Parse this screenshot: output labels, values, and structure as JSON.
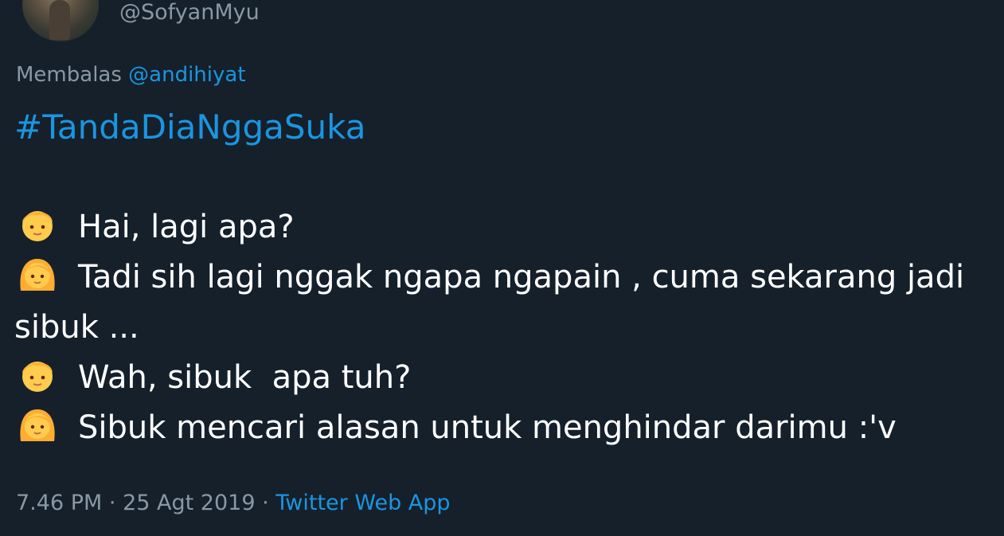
{
  "tweet": {
    "handle": "@SofyanMyu",
    "reply_prefix": "Membalas",
    "reply_to": "@andihiyat",
    "hashtag": "#TandaDiaNggaSuka",
    "dialogue": [
      {
        "speaker_icon": "boy-emoji-icon",
        "text": "Hai, lagi apa?"
      },
      {
        "speaker_icon": "girl-emoji-icon",
        "text": "Tadi sih lagi nggak ngapa ngapain , cuma sekarang jadi sibuk ..."
      },
      {
        "speaker_icon": "boy-emoji-icon",
        "text": "Wah, sibuk  apa tuh?"
      },
      {
        "speaker_icon": "girl-emoji-icon",
        "text": "Sibuk mencari alasan untuk menghindar darimu :'v"
      }
    ],
    "time": "7.46 PM",
    "date": "25 Agt 2019",
    "separator": "·",
    "source": "Twitter Web App"
  },
  "colors": {
    "background": "#15202b",
    "secondary_text": "#8899a6",
    "link": "#1b95e0",
    "primary_text": "#ffffff",
    "emoji_skin": "#ffcc4d",
    "emoji_hair": "#ffac33"
  }
}
